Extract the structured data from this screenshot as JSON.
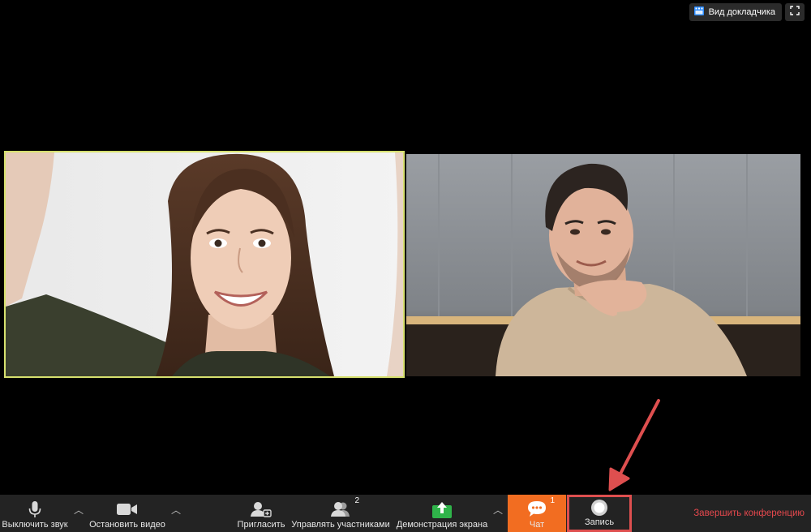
{
  "top_bar": {
    "speaker_view_label": "Вид докладчика",
    "speaker_view_icon": "grid-icon",
    "fullscreen_icon": "fullscreen-icon"
  },
  "participants": [
    {
      "description": "woman smiling, selfie",
      "active_speaker": true
    },
    {
      "description": "man with hand on chin",
      "active_speaker": false
    }
  ],
  "toolbar": {
    "mute_label": "Выключить звук",
    "stop_video_label": "Остановить видео",
    "invite_label": "Пригласить",
    "manage_participants_label": "Управлять участниками",
    "participants_count": "2",
    "share_screen_label": "Демонстрация экрана",
    "chat_label": "Чат",
    "chat_count": "1",
    "record_label": "Запись",
    "end_meeting_label": "Завершить конференцию"
  },
  "colors": {
    "background": "#000000",
    "toolbar": "#232323",
    "chat_accent": "#f26d21",
    "share_green": "#2fb44a",
    "highlight_red": "#de4f4f",
    "end_red": "#e5484d",
    "active_speaker_border": "#d6e06e"
  }
}
